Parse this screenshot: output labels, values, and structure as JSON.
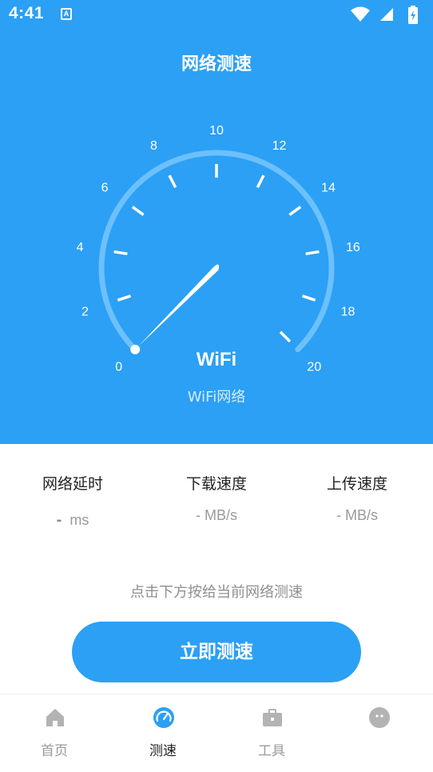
{
  "status_bar": {
    "time": "4:41",
    "notification_icon": "a-letter-icon",
    "icons": [
      "wifi-icon",
      "cell-signal-icon",
      "battery-charging-icon"
    ]
  },
  "header": {
    "title": "网络测速"
  },
  "gauge": {
    "scale_labels": [
      "0",
      "2",
      "4",
      "6",
      "8",
      "10",
      "12",
      "14",
      "16",
      "18",
      "20"
    ],
    "current_value": 0,
    "connection_type": "WiFi",
    "connection_subtitle": "WiFi网络"
  },
  "metrics": [
    {
      "label": "网络延时",
      "value": "-",
      "unit": "ms"
    },
    {
      "label": "下载速度",
      "value": "-",
      "unit": "MB/s"
    },
    {
      "label": "上传速度",
      "value": "-",
      "unit": "MB/s"
    }
  ],
  "hint": "点击下方按给当前网络测速",
  "action_button": {
    "label": "立即测速"
  },
  "bottom_nav": [
    {
      "label": "首页",
      "icon": "home-icon",
      "active": false
    },
    {
      "label": "测速",
      "icon": "speedometer-icon",
      "active": true
    },
    {
      "label": "工具",
      "icon": "toolbox-icon",
      "active": false
    },
    {
      "label": "",
      "icon": "bird-face-icon",
      "active": false
    }
  ],
  "colors": {
    "primary": "#2ba0f5",
    "arc": "#6cc0fb",
    "text_dark": "#222222",
    "text_muted": "#9a9a9a"
  }
}
